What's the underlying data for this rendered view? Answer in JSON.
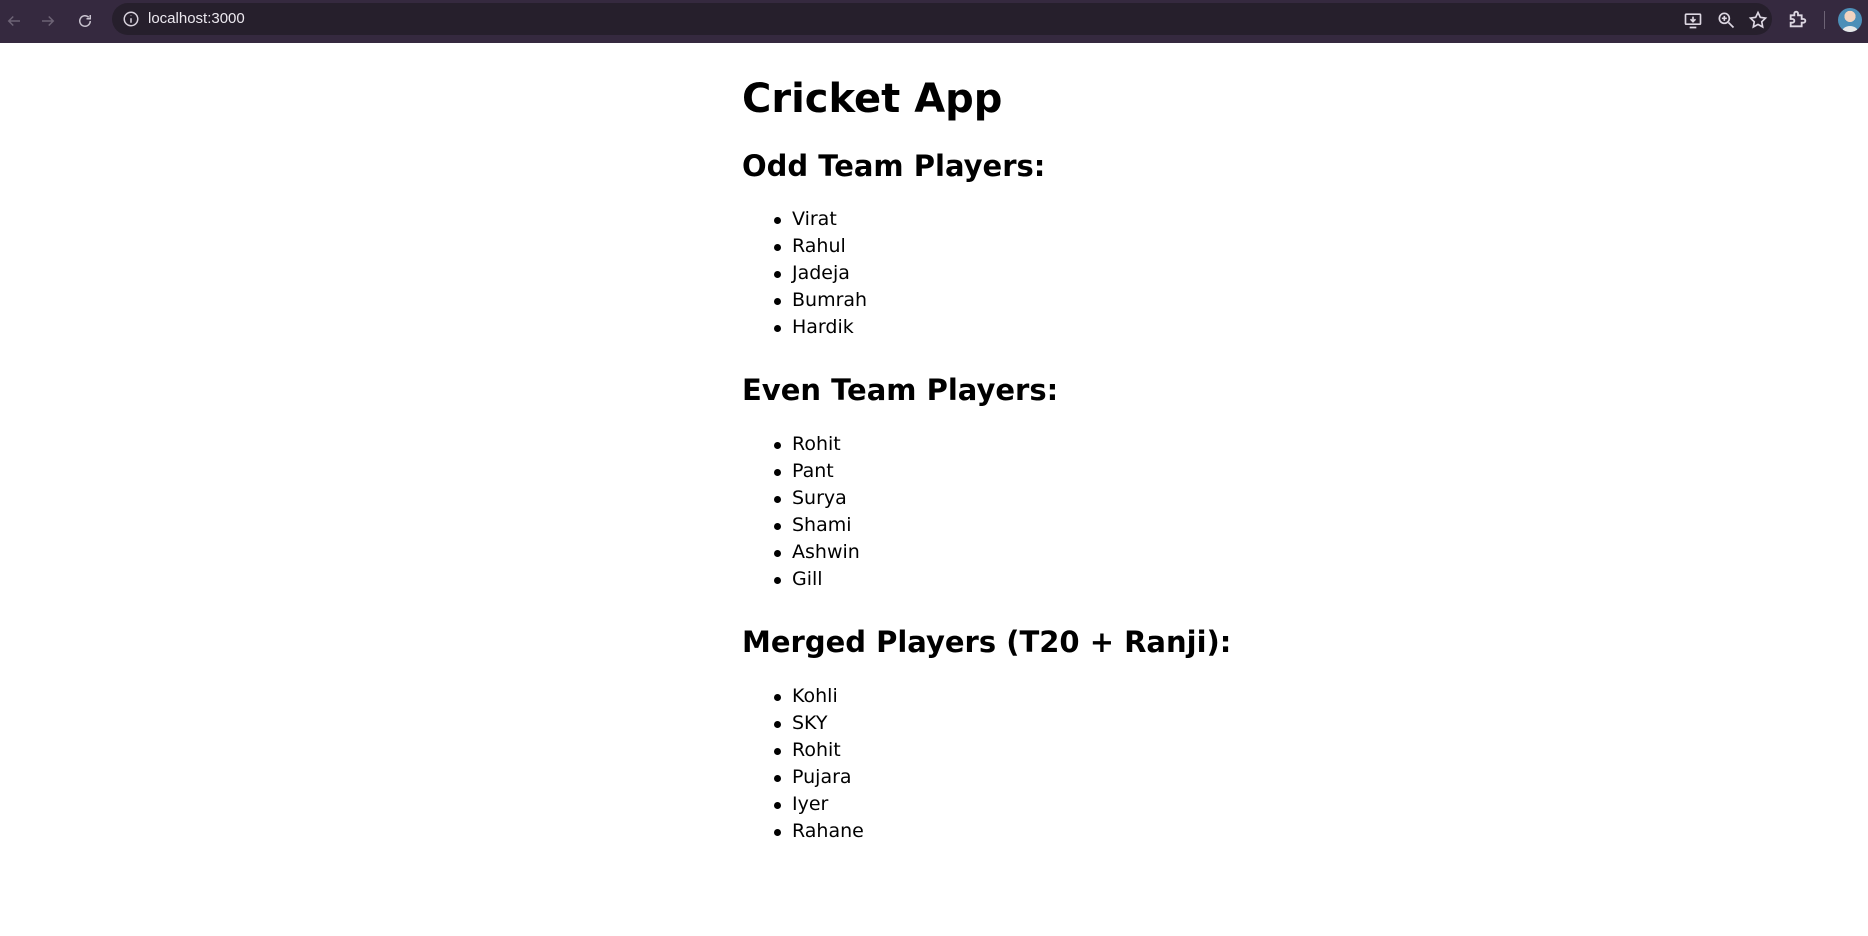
{
  "browser": {
    "url": "localhost:3000"
  },
  "page": {
    "title": "Cricket App",
    "sections": [
      {
        "heading": "Odd Team Players:",
        "players": [
          "Virat",
          "Rahul",
          "Jadeja",
          "Bumrah",
          "Hardik"
        ]
      },
      {
        "heading": "Even Team Players:",
        "players": [
          "Rohit",
          "Pant",
          "Surya",
          "Shami",
          "Ashwin",
          "Gill"
        ]
      },
      {
        "heading": "Merged Players (T20 + Ranji):",
        "players": [
          "Kohli",
          "SKY",
          "Rohit",
          "Pujara",
          "Iyer",
          "Rahane"
        ]
      }
    ]
  },
  "icons": {
    "back": "back-arrow-icon",
    "forward": "forward-arrow-icon",
    "reload": "reload-icon",
    "site_info": "info-icon",
    "install": "install-app-icon",
    "zoom": "zoom-icon",
    "bookmark": "star-icon",
    "extensions": "puzzle-icon",
    "profile": "avatar"
  }
}
